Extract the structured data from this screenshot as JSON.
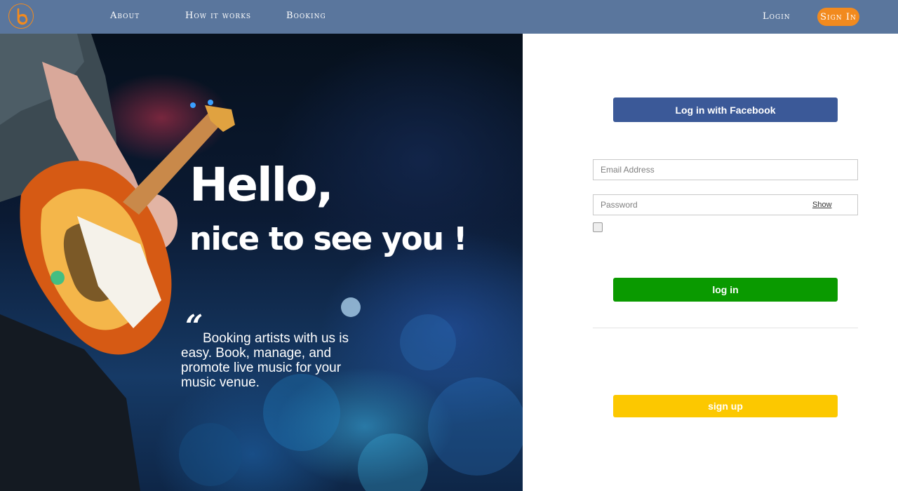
{
  "nav": {
    "logo_icon": "bc-logo-icon",
    "items": [
      {
        "label": "About"
      },
      {
        "label": "How it works"
      },
      {
        "label": "Booking"
      }
    ],
    "login_label": "Login",
    "signin_label": "Sign In"
  },
  "hero": {
    "title": "Hello,",
    "subtitle": "nice to see you !",
    "quote_mark": "“",
    "quote": "Booking artists with us is easy. Book, manage, and promote live music for your music venue."
  },
  "form": {
    "facebook_label": "Log in with Facebook",
    "email_placeholder": "Email Address",
    "password_placeholder": "Password",
    "show_label": "Show",
    "login_label": "log in",
    "signup_label": "sign up"
  },
  "colors": {
    "nav_bg": "#5a769d",
    "accent_orange": "#f28a1e",
    "facebook_blue": "#3b5998",
    "login_green": "#0a9a00",
    "signup_yellow": "#fcc800"
  }
}
